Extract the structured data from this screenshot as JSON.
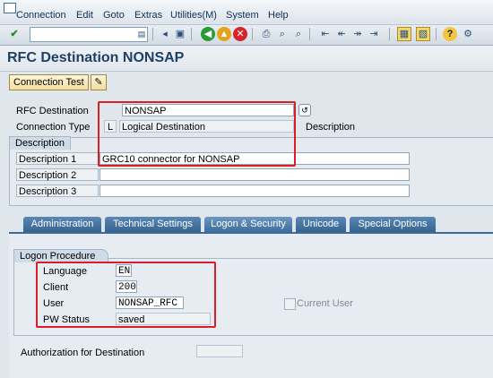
{
  "menu": {
    "items": [
      "Connection",
      "Edit",
      "Goto",
      "Extras",
      "Utilities(M)",
      "System",
      "Help"
    ]
  },
  "toolbar": {
    "command_value": "",
    "icons": [
      "enter-icon",
      "save-icon",
      "back-icon",
      "exit-icon",
      "cancel-icon",
      "print-icon",
      "find-icon",
      "find-next-icon",
      "first-page-icon",
      "prev-page-icon",
      "next-page-icon",
      "last-page-icon",
      "create-session-icon",
      "shortcut-icon",
      "help-icon",
      "customize-layout-icon"
    ]
  },
  "page": {
    "title": "RFC Destination NONSAP"
  },
  "app_toolbar": {
    "connection_test_label": "Connection Test"
  },
  "form": {
    "rfc_destination_label": "RFC Destination",
    "rfc_destination_value": "NONSAP",
    "connection_type_label": "Connection Type",
    "connection_type_code": "L",
    "connection_type_text": "Logical Destination",
    "description_header_label": "Description",
    "description_group_label": "Description",
    "description1_label": "Description 1",
    "description1_value": "GRC10 connector for NONSAP",
    "description2_label": "Description 2",
    "description2_value": "",
    "description3_label": "Description 3",
    "description3_value": ""
  },
  "tabs": [
    {
      "label": "Administration",
      "active": false
    },
    {
      "label": "Technical Settings",
      "active": false
    },
    {
      "label": "Logon & Security",
      "active": true
    },
    {
      "label": "Unicode",
      "active": false
    },
    {
      "label": "Special Options",
      "active": false
    }
  ],
  "logon": {
    "group_label": "Logon Procedure",
    "language_label": "Language",
    "language_value": "EN",
    "client_label": "Client",
    "client_value": "200",
    "user_label": "User",
    "user_value": "NONSAP_RFC",
    "pw_status_label": "PW Status",
    "pw_status_value": "saved",
    "current_user_label": "Current User",
    "authorization_label": "Authorization for Destination",
    "authorization_value": ""
  },
  "colors": {
    "highlight": "#d61f26",
    "title": "#1f3f66",
    "tab": "#36648f"
  }
}
